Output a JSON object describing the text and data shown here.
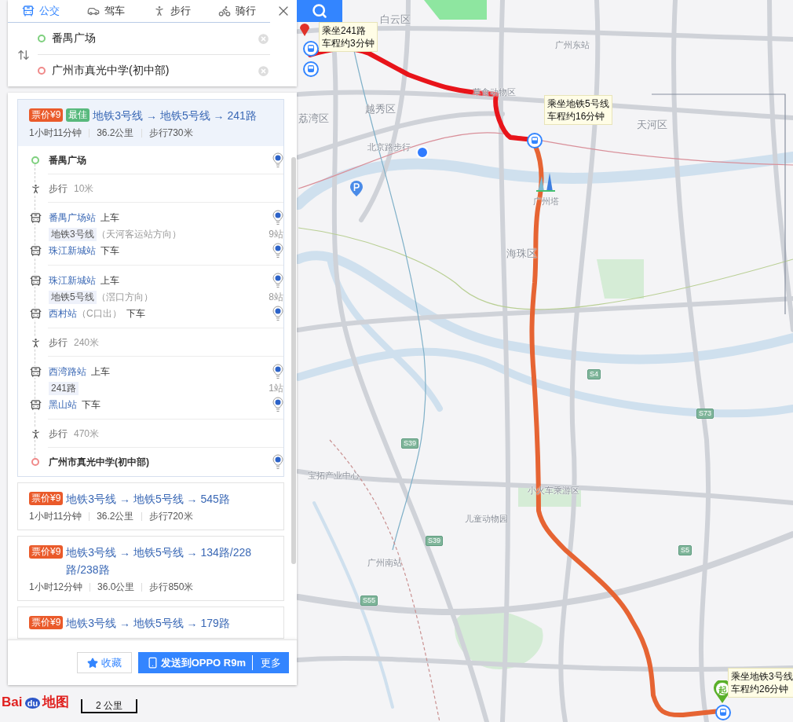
{
  "mode_tabs": [
    {
      "label": "公交",
      "kind": "bus",
      "selected": true
    },
    {
      "label": "驾车",
      "kind": "car",
      "selected": false
    },
    {
      "label": "步行",
      "kind": "walk",
      "selected": false
    },
    {
      "label": "骑行",
      "kind": "bike",
      "selected": false
    }
  ],
  "origin": {
    "value": "番禺广场",
    "color": "#7ed07e"
  },
  "destination": {
    "value": "广州市真光中学(初中部)",
    "color": "#f08a8a"
  },
  "routes": [
    {
      "price": "票价¥9",
      "badge": "最佳",
      "title": "地铁3号线 → 地铁5号线 → 241路",
      "duration": "1小时11分钟",
      "distance": "36.2公里",
      "walk": "步行730米",
      "selected": true,
      "expanded": true,
      "steps": [
        {
          "kind": "place",
          "name": "番禺广场",
          "color": "#7ed07e"
        },
        {
          "kind": "walk",
          "label": "步行",
          "distance": "10米"
        },
        {
          "kind": "ride",
          "board_station": "番禺广场站",
          "board_action": "上车",
          "line": "地铁3号线",
          "direction": "（天河客运站方向）",
          "stops": "9站",
          "alight_station": "珠江新城站",
          "alight_action": "下车"
        },
        {
          "kind": "ride",
          "board_station": "珠江新城站",
          "board_action": "上车",
          "line": "地铁5号线",
          "direction": "（滘口方向）",
          "stops": "8站",
          "alight_station": "西村站",
          "alight_note": "（C口出）",
          "alight_action": "下车"
        },
        {
          "kind": "walk",
          "label": "步行",
          "distance": "240米"
        },
        {
          "kind": "ride",
          "board_station": "西湾路站",
          "board_action": "上车",
          "line": "241路",
          "stops": "1站",
          "alight_station": "黑山站",
          "alight_action": "下车"
        },
        {
          "kind": "walk",
          "label": "步行",
          "distance": "470米"
        },
        {
          "kind": "place",
          "name": "广州市真光中学(初中部)",
          "color": "#f08a8a"
        }
      ]
    },
    {
      "price": "票价¥9",
      "title": "地铁3号线 → 地铁5号线 → 545路",
      "duration": "1小时11分钟",
      "distance": "36.2公里",
      "walk": "步行720米",
      "selected": false
    },
    {
      "price": "票价¥9",
      "title": "地铁3号线 → 地铁5号线 → 134路/228路/238路",
      "duration": "1小时12分钟",
      "distance": "36.0公里",
      "walk": "步行850米",
      "selected": false
    },
    {
      "price": "票价¥9",
      "title": "地铁3号线 → 地铁5号线 → 179路",
      "selected": false
    }
  ],
  "actions": {
    "save": "收藏",
    "send": "发送到OPPO R9m",
    "more": "更多"
  },
  "map": {
    "district_labels": [
      "白云区",
      "越秀区",
      "荔湾区",
      "天河区",
      "海珠区"
    ],
    "poi_labels": [
      "广州东站",
      "草食动物区",
      "北京路步行",
      "广州塔",
      "宝拓产业中心",
      "小火车乘游区",
      "儿童动物园",
      "广州南站"
    ],
    "road_shields": [
      "S4",
      "S73",
      "S39",
      "S39",
      "S55",
      "S5"
    ],
    "callouts": [
      {
        "line1": "乘坐241路",
        "line2": "车程约3分钟"
      },
      {
        "line1": "乘坐地铁5号线",
        "line2": "车程约16分钟"
      },
      {
        "line1": "乘坐地铁3号线",
        "line2": "车程约26分钟"
      }
    ],
    "start_marker": "起",
    "scale": "2 公里",
    "logo": {
      "left": "Bai",
      "paw": "du",
      "right": "地图"
    }
  }
}
